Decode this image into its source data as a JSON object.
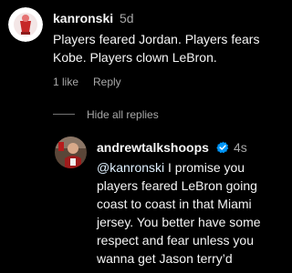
{
  "comment": {
    "username": "kanronski",
    "time": "5d",
    "text_lines": [
      "Players feared Jordan. Players fears",
      "Kobe. Players clown LeBron."
    ],
    "like_count": "1 like",
    "reply_label": "Reply"
  },
  "hide_replies_label": "Hide all replies",
  "reply": {
    "username": "andrewtalkshoops",
    "verified_icon": "verified-badge-icon",
    "time": "4s",
    "mention": "@kanronski",
    "first_line_rest": " I promise you",
    "text_lines": [
      "players feared LeBron going",
      "coast to coast in that Miami",
      "jersey. You better have some",
      "respect and fear unless you",
      "wanna get Jason terry’d"
    ]
  },
  "colors": {
    "background": "#000000",
    "text_primary": "#f5f5f5",
    "text_secondary": "#a8a8a8",
    "mention": "#e0f1ff",
    "verified_badge": "#0095f6"
  }
}
